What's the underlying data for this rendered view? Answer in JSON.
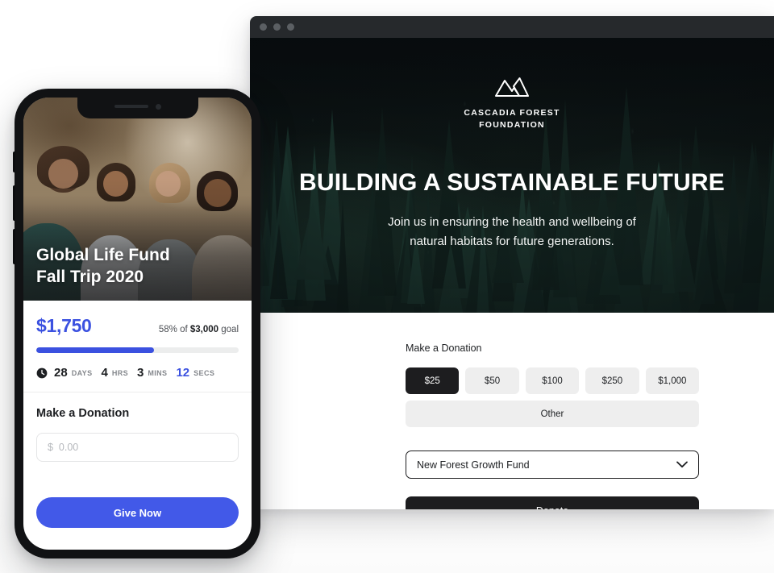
{
  "browser": {
    "titlebar": {
      "dots": [
        "window-close",
        "window-minimize",
        "window-zoom"
      ]
    },
    "hero": {
      "logo_icon": "mountain-range-icon",
      "brand_line_1": "CASCADIA FOREST",
      "brand_line_2": "FOUNDATION",
      "headline": "BUILDING A SUSTAINABLE FUTURE",
      "sub_line_1": "Join us in ensuring the health and wellbeing of",
      "sub_line_2": "natural habitats for future generations."
    },
    "donation": {
      "heading": "Make a Donation",
      "amounts": [
        {
          "label": "$25",
          "selected": true
        },
        {
          "label": "$50",
          "selected": false
        },
        {
          "label": "$100",
          "selected": false
        },
        {
          "label": "$250",
          "selected": false
        },
        {
          "label": "$1,000",
          "selected": false
        }
      ],
      "other_label": "Other",
      "fund_value": "New Forest Growth Fund",
      "fund_chevron_icon": "chevron-down-icon",
      "donate_label": "Donate"
    }
  },
  "phone": {
    "photo_alt": "four-women-laughing-outdoors",
    "campaign_title_line_1": "Global Life Fund",
    "campaign_title_line_2": "Fall Trip 2020",
    "stats": {
      "raised": "$1,750",
      "goal_prefix": "58% of ",
      "goal_amount": "$3,000",
      "goal_suffix": " goal",
      "progress_percent": 58
    },
    "countdown": {
      "clock_icon": "clock-icon",
      "days_value": "28",
      "days_unit": "DAYS",
      "hours_value": "4",
      "hours_unit": "HRS",
      "mins_value": "3",
      "mins_unit": "MINS",
      "secs_value": "12",
      "secs_unit": "SECS"
    },
    "donation": {
      "heading": "Make a Donation",
      "input_placeholder": "$  0.00",
      "input_value": "",
      "give_label": "Give Now"
    }
  },
  "colors": {
    "accent_blue": "#3B51E0",
    "button_blue": "#4259E8",
    "dark": "#1D1D1F",
    "chip_gray": "#EEEEEE"
  }
}
